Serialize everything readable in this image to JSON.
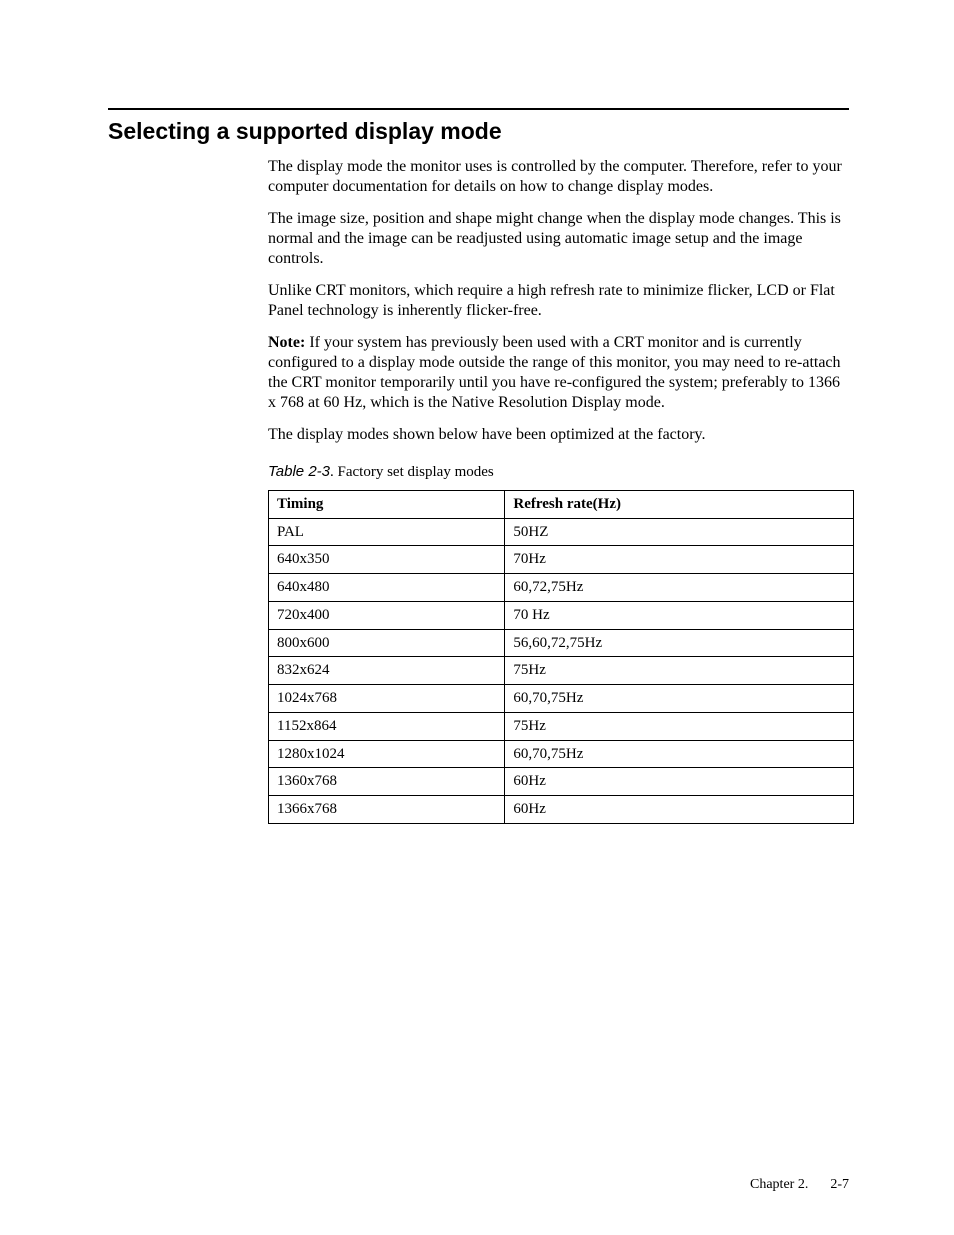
{
  "heading": "Selecting a supported display mode",
  "paragraphs": {
    "p1": "The display mode the monitor uses is controlled by the computer. Therefore, refer to your computer documentation for details on how to change display modes.",
    "p2": "The image size, position and shape might change when the display mode changes. This is normal and the image can be readjusted using automatic image setup and the image controls.",
    "p3": "Unlike CRT monitors, which require a high refresh rate to minimize flicker, LCD or Flat Panel technology is inherently flicker-free.",
    "note_label": "Note:",
    "p4_note": "  If your system has previously been used with a CRT monitor and is currently configured to a display mode outside the range of this monitor, you may need to re-attach the CRT monitor temporarily until you have re-configured the system; preferably to 1366 x 768 at 60 Hz, which is the Native Resolution Display mode.",
    "p5": "The display modes shown below have been optimized at the factory."
  },
  "table": {
    "caption_prefix": "Table 2-3",
    "caption_suffix": ". Factory set display modes",
    "headers": {
      "timing": "Timing",
      "refresh": "Refresh rate(Hz)"
    },
    "rows": [
      {
        "timing": "PAL",
        "refresh": "50HZ"
      },
      {
        "timing": "640x350",
        "refresh": "70Hz"
      },
      {
        "timing": "640x480",
        "refresh": "60,72,75Hz"
      },
      {
        "timing": "720x400",
        "refresh": "70 Hz"
      },
      {
        "timing": "800x600",
        "refresh": "56,60,72,75Hz"
      },
      {
        "timing": "832x624",
        "refresh": "75Hz"
      },
      {
        "timing": "1024x768",
        "refresh": "60,70,75Hz"
      },
      {
        "timing": "1152x864",
        "refresh": "75Hz"
      },
      {
        "timing": "1280x1024",
        "refresh": "60,70,75Hz"
      },
      {
        "timing": "1360x768",
        "refresh": "60Hz"
      },
      {
        "timing": "1366x768",
        "refresh": "60Hz"
      }
    ]
  },
  "footer": {
    "chapter": "Chapter 2.",
    "page": "2-7"
  }
}
